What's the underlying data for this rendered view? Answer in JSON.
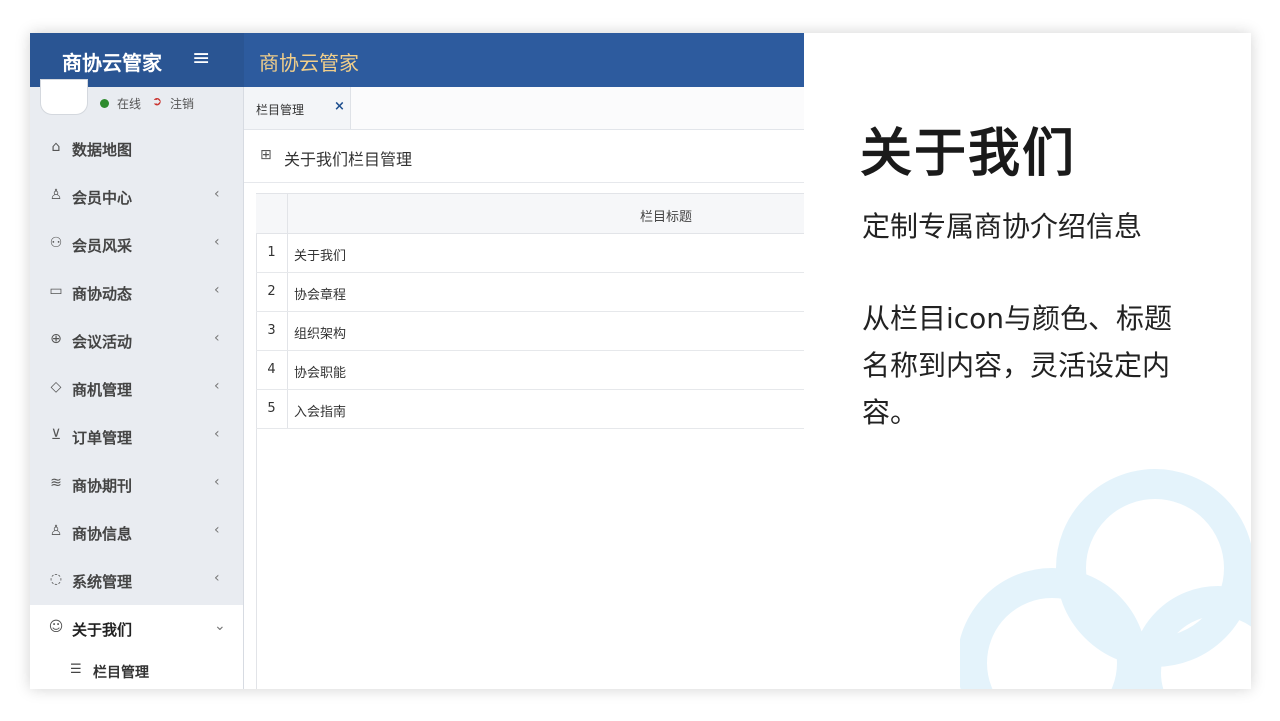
{
  "app": {
    "brand": "商协云管家",
    "menu_icon": "hamburger-icon",
    "header_title": "商协云管家"
  },
  "user": {
    "status": "在线",
    "logout": "注销"
  },
  "sidebar": {
    "items": [
      {
        "label": "数据地图",
        "icon": "home-icon"
      },
      {
        "label": "会员中心",
        "icon": "user-icon",
        "chevron": "‹"
      },
      {
        "label": "会员风采",
        "icon": "users-icon",
        "chevron": "‹"
      },
      {
        "label": "商协动态",
        "icon": "message-icon",
        "chevron": "‹"
      },
      {
        "label": "会议活动",
        "icon": "globe-icon",
        "chevron": "‹"
      },
      {
        "label": "商机管理",
        "icon": "diamond-icon",
        "chevron": "‹"
      },
      {
        "label": "订单管理",
        "icon": "cart-icon",
        "chevron": "‹"
      },
      {
        "label": "商协期刊",
        "icon": "layers-icon",
        "chevron": "‹"
      },
      {
        "label": "商协信息",
        "icon": "person-icon",
        "chevron": "‹"
      },
      {
        "label": "系统管理",
        "icon": "chat-icon",
        "chevron": "‹"
      },
      {
        "label": "关于我们",
        "icon": "smile-icon",
        "chevron": "⌄"
      }
    ],
    "sub_item": {
      "label": "栏目管理",
      "icon": "list-icon"
    }
  },
  "tabs": [
    {
      "label": "栏目管理",
      "close": "×"
    }
  ],
  "section": {
    "title": "关于我们栏目管理",
    "icon": "grid-icon"
  },
  "table": {
    "header": "栏目标题",
    "rows": [
      {
        "num": "1",
        "title": "关于我们"
      },
      {
        "num": "2",
        "title": "协会章程"
      },
      {
        "num": "3",
        "title": "组织架构"
      },
      {
        "num": "4",
        "title": "协会职能"
      },
      {
        "num": "5",
        "title": "入会指南"
      }
    ]
  },
  "promo": {
    "title": "关于我们",
    "subtitle": "定制专属商协介绍信息",
    "body": "从栏目icon与颜色、标题名称到内容，灵活设定内容。",
    "colors": {
      "accent": "#2d5b9e",
      "deco": "#e4f3fb"
    }
  }
}
